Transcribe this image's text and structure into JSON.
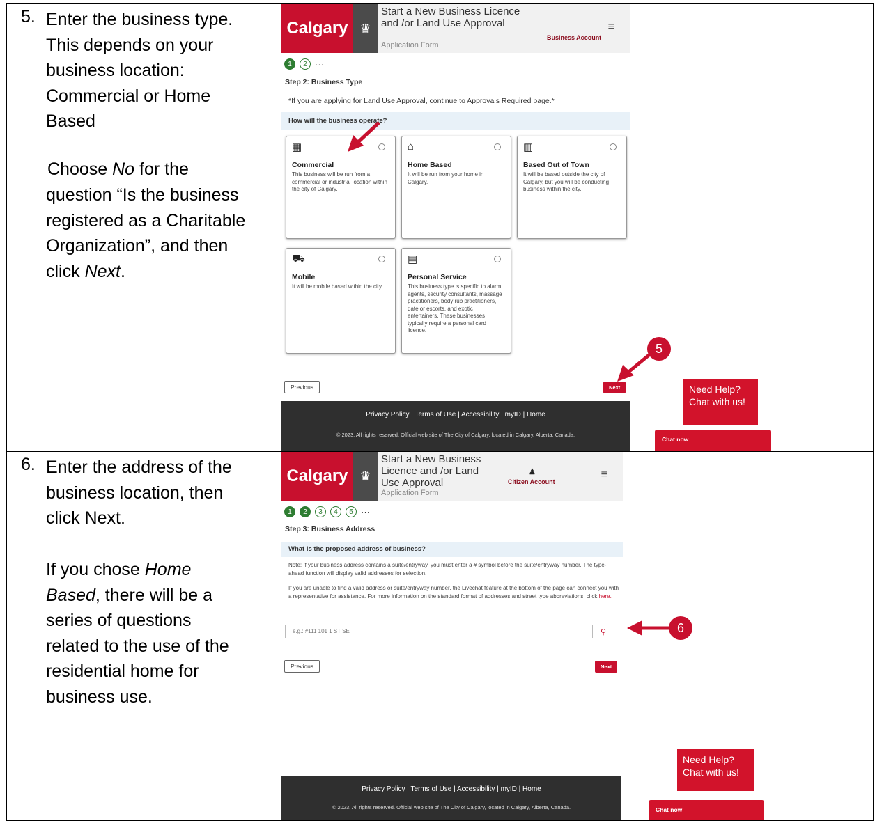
{
  "step5": {
    "number": "5.",
    "lines": [
      "Enter the business type.",
      "This depends on your",
      "business location:",
      "Commercial or Home",
      "Based"
    ],
    "choose_prefix": "Choose ",
    "choose_no": "No",
    "choose_mid": " for the",
    "q_lines": [
      "question “Is the business",
      "registered as a Charitable",
      "Organization”, and then"
    ],
    "click_prefix": "click ",
    "click_next": "Next",
    "click_suffix": ".",
    "screen": {
      "brand": "Calgary",
      "title": "Start a New Business Licence and /or Land Use Approval",
      "subtitle": "Application Form",
      "account": "Business Account",
      "dots": [
        "1",
        "2"
      ],
      "more": "···",
      "step_heading": "Step 2: Business Type",
      "note": "*If you are applying for Land Use Approval, continue to Approvals Required page.*",
      "question": "How will the business operate?",
      "cards": [
        {
          "icon": "▦",
          "title": "Commercial",
          "desc": "This business will be run from a commercial or industrial location within the city of Calgary."
        },
        {
          "icon": "⌂",
          "title": "Home Based",
          "desc": "It will be run from your home in Calgary."
        },
        {
          "icon": "▥",
          "title": "Based Out of Town",
          "desc": "It will be based outside the city of Calgary, but you will be conducting business within the city."
        },
        {
          "icon": "⛟",
          "title": "Mobile",
          "desc": "It will be mobile based within the city."
        },
        {
          "icon": "▤",
          "title": "Personal Service",
          "desc": "This business type is specific to alarm agents, security consultants, massage practitioners, body rub practitioners, date or escorts, and exotic entertainers. These businesses typically require a personal card licence."
        }
      ],
      "prev": "Previous",
      "next": "Next",
      "footer_links": "Privacy Policy | Terms of Use | Accessibility | myID | Home",
      "footer_copy": "© 2023. All rights reserved. Official web site of The City of Calgary, located in Calgary, Alberta, Canada.",
      "help": "Need Help? Chat with us!",
      "chat": "Chat now",
      "callout": "5"
    }
  },
  "step6": {
    "number": "6.",
    "lines": [
      "Enter the address of the",
      "business location, then",
      "click Next."
    ],
    "if_prefix": "If you chose ",
    "home_based_1": "Home",
    "home_based_2": "Based",
    "rest_first": ", there will be a",
    "rest_lines": [
      "series of questions",
      "related to the use of the",
      "residential home for",
      "business use."
    ],
    "screen": {
      "brand": "Calgary",
      "title": "Start a New Business Licence and /or Land Use Approval",
      "subtitle": "Application Form",
      "account": "Citizen Account",
      "dots": [
        "1",
        "2",
        "3",
        "4",
        "5"
      ],
      "more": "···",
      "step_heading": "Step 3: Business Address",
      "question": "What is the proposed address of business?",
      "note1": "Note: If your business address contains a suite/entryway, you must enter a # symbol before the suite/entryway number. The type-ahead function will display valid addresses for selection.",
      "note2": "If you are unable to find a valid address or suite/entryway number, the Livechat feature at the bottom of the page can connect you with a representative for assistance. For more information on the standard format of addresses and street type abbreviations, click ",
      "link": "here.",
      "placeholder": "e.g.: #111 101 1 ST SE",
      "prev": "Previous",
      "next": "Next",
      "footer_links": "Privacy Policy | Terms of Use | Accessibility | myID | Home",
      "footer_copy": "© 2023. All rights reserved. Official web site of The City of Calgary, located in Calgary, Alberta, Canada.",
      "help": "Need Help? Chat with us!",
      "chat": "Chat now",
      "callout": "6"
    }
  },
  "colors": {
    "brand_red": "#c8102e",
    "progress_green": "#2e7d32",
    "footer_dark": "#2f2f2f"
  }
}
